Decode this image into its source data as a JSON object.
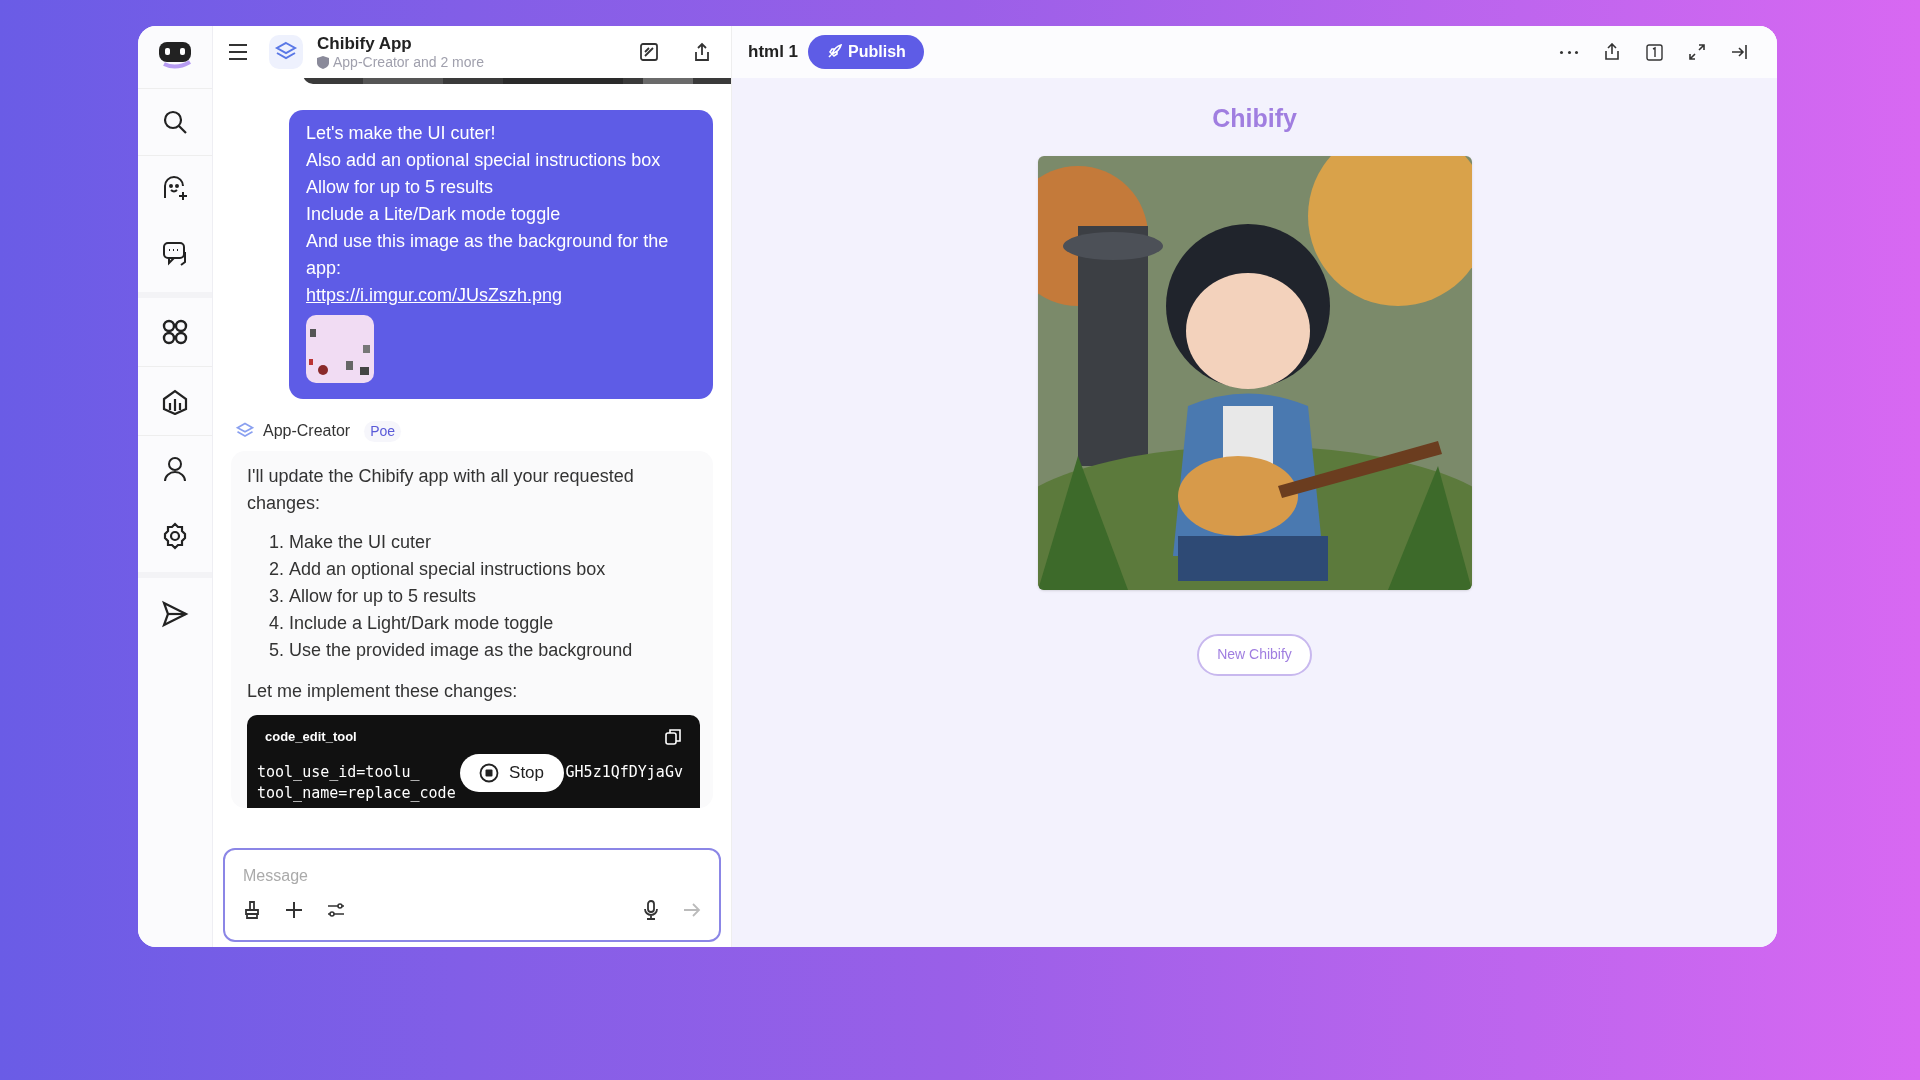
{
  "header": {
    "title": "Chibify App",
    "subtitle": "App-Creator and 2 more"
  },
  "user_message": {
    "lines": [
      "Let's make the UI cuter!",
      "Also add an optional special instructions box",
      "Allow for up to 5 results",
      "Include a Lite/Dark mode toggle",
      "And use this image as the background for the app:"
    ],
    "link": "https://i.imgur.com/JUsZszh.png"
  },
  "bot_message": {
    "author": "App-Creator",
    "badge": "Poe",
    "intro": "I'll update the Chibify app with all your requested changes:",
    "list": [
      "Make the UI cuter",
      "Add an optional special instructions box",
      "Allow for up to 5 results",
      "Include a Light/Dark mode toggle",
      "Use the provided image as the background"
    ],
    "numbers": [
      "1.",
      "2.",
      "3.",
      "4.",
      "5."
    ],
    "outro": "Let me implement these changes:",
    "code": {
      "title": "code_edit_tool",
      "line_1_start": "tool_use_id=toolu_",
      "line_1_end": "GH5z1QfDYjaGv",
      "line_2": "tool_name=replace_code"
    }
  },
  "stop_button": "Stop",
  "composer": {
    "placeholder": "Message"
  },
  "preview": {
    "tab": "html 1",
    "publish": "Publish",
    "title": "Chibify",
    "button": "New Chibify"
  }
}
